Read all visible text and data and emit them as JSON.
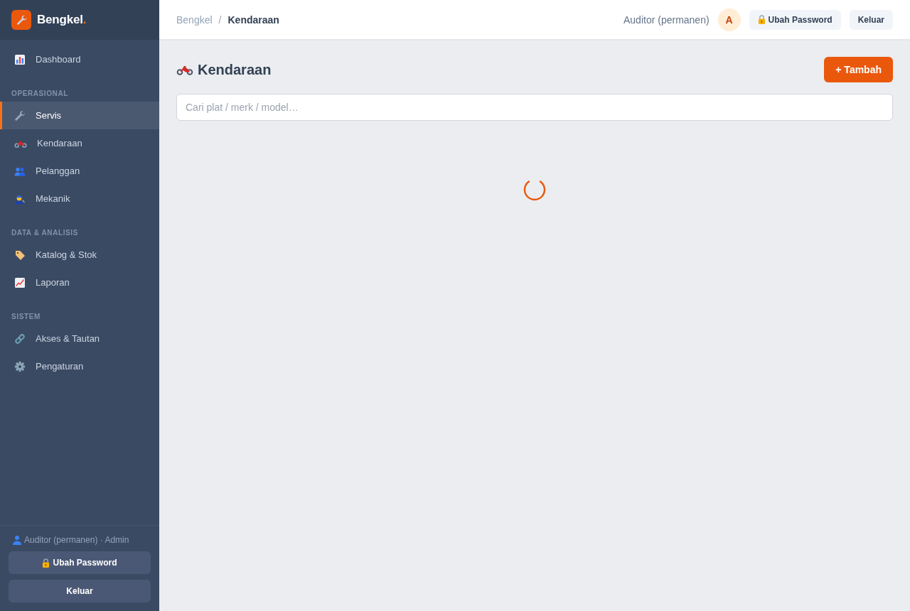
{
  "sidebar": {
    "brand": {
      "name": "Bengkel",
      "mark": "."
    },
    "groups": [
      {
        "items": [
          {
            "label": "Dashboard",
            "selected": false
          }
        ]
      },
      {
        "title": "OPERASIONAL",
        "items": [
          {
            "label": "Servis",
            "selected": true
          },
          {
            "label": "Kendaraan",
            "selected": false
          },
          {
            "label": "Pelanggan",
            "selected": false
          },
          {
            "label": "Mekanik",
            "selected": false
          }
        ]
      },
      {
        "title": "DATA & ANALISIS",
        "items": [
          {
            "label": "Katalog & Stok",
            "selected": false
          },
          {
            "label": "Laporan",
            "selected": false
          }
        ]
      },
      {
        "title": "SISTEM",
        "items": [
          {
            "label": "Akses & Tautan",
            "selected": false
          },
          {
            "label": "Pengaturan",
            "selected": false
          }
        ]
      }
    ],
    "footer": {
      "user": "Auditor (permanen) · Admin",
      "buttons": [
        "Ubah Password",
        "Keluar"
      ]
    }
  },
  "topbar": {
    "breadcrumb": [
      {
        "label": "Bengkel",
        "current": false
      },
      {
        "label": "Kendaraan",
        "current": true
      }
    ],
    "separator": "/",
    "user": "Auditor (permanen)",
    "avatar": "A",
    "buttons": [
      "Ubah Password",
      "Keluar"
    ]
  },
  "page": {
    "title": "Kendaraan",
    "add_button": "+ Tambah",
    "search": {
      "placeholder": "Cari plat / merk / model…"
    },
    "loading": true
  }
}
